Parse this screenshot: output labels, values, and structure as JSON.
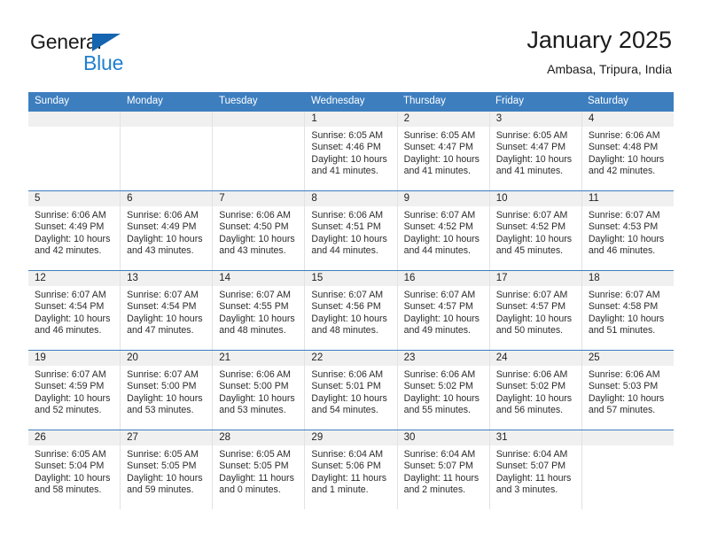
{
  "brand": {
    "word_one": "General",
    "word_two": "Blue",
    "accent_color": "#1f7fd0",
    "triangle_color": "#1565b0"
  },
  "header": {
    "title": "January 2025",
    "subtitle": "Ambasa, Tripura, India"
  },
  "calendar": {
    "header_bg": "#3d7ebf",
    "header_text_color": "#ffffff",
    "day_band_bg": "#f0f0f0",
    "weekdays": [
      "Sunday",
      "Monday",
      "Tuesday",
      "Wednesday",
      "Thursday",
      "Friday",
      "Saturday"
    ],
    "weeks": [
      [
        {
          "day": "",
          "sunrise": "",
          "sunset": "",
          "daylight_1": "",
          "daylight_2": ""
        },
        {
          "day": "",
          "sunrise": "",
          "sunset": "",
          "daylight_1": "",
          "daylight_2": ""
        },
        {
          "day": "",
          "sunrise": "",
          "sunset": "",
          "daylight_1": "",
          "daylight_2": ""
        },
        {
          "day": "1",
          "sunrise": "Sunrise: 6:05 AM",
          "sunset": "Sunset: 4:46 PM",
          "daylight_1": "Daylight: 10 hours",
          "daylight_2": "and 41 minutes."
        },
        {
          "day": "2",
          "sunrise": "Sunrise: 6:05 AM",
          "sunset": "Sunset: 4:47 PM",
          "daylight_1": "Daylight: 10 hours",
          "daylight_2": "and 41 minutes."
        },
        {
          "day": "3",
          "sunrise": "Sunrise: 6:05 AM",
          "sunset": "Sunset: 4:47 PM",
          "daylight_1": "Daylight: 10 hours",
          "daylight_2": "and 41 minutes."
        },
        {
          "day": "4",
          "sunrise": "Sunrise: 6:06 AM",
          "sunset": "Sunset: 4:48 PM",
          "daylight_1": "Daylight: 10 hours",
          "daylight_2": "and 42 minutes."
        }
      ],
      [
        {
          "day": "5",
          "sunrise": "Sunrise: 6:06 AM",
          "sunset": "Sunset: 4:49 PM",
          "daylight_1": "Daylight: 10 hours",
          "daylight_2": "and 42 minutes."
        },
        {
          "day": "6",
          "sunrise": "Sunrise: 6:06 AM",
          "sunset": "Sunset: 4:49 PM",
          "daylight_1": "Daylight: 10 hours",
          "daylight_2": "and 43 minutes."
        },
        {
          "day": "7",
          "sunrise": "Sunrise: 6:06 AM",
          "sunset": "Sunset: 4:50 PM",
          "daylight_1": "Daylight: 10 hours",
          "daylight_2": "and 43 minutes."
        },
        {
          "day": "8",
          "sunrise": "Sunrise: 6:06 AM",
          "sunset": "Sunset: 4:51 PM",
          "daylight_1": "Daylight: 10 hours",
          "daylight_2": "and 44 minutes."
        },
        {
          "day": "9",
          "sunrise": "Sunrise: 6:07 AM",
          "sunset": "Sunset: 4:52 PM",
          "daylight_1": "Daylight: 10 hours",
          "daylight_2": "and 44 minutes."
        },
        {
          "day": "10",
          "sunrise": "Sunrise: 6:07 AM",
          "sunset": "Sunset: 4:52 PM",
          "daylight_1": "Daylight: 10 hours",
          "daylight_2": "and 45 minutes."
        },
        {
          "day": "11",
          "sunrise": "Sunrise: 6:07 AM",
          "sunset": "Sunset: 4:53 PM",
          "daylight_1": "Daylight: 10 hours",
          "daylight_2": "and 46 minutes."
        }
      ],
      [
        {
          "day": "12",
          "sunrise": "Sunrise: 6:07 AM",
          "sunset": "Sunset: 4:54 PM",
          "daylight_1": "Daylight: 10 hours",
          "daylight_2": "and 46 minutes."
        },
        {
          "day": "13",
          "sunrise": "Sunrise: 6:07 AM",
          "sunset": "Sunset: 4:54 PM",
          "daylight_1": "Daylight: 10 hours",
          "daylight_2": "and 47 minutes."
        },
        {
          "day": "14",
          "sunrise": "Sunrise: 6:07 AM",
          "sunset": "Sunset: 4:55 PM",
          "daylight_1": "Daylight: 10 hours",
          "daylight_2": "and 48 minutes."
        },
        {
          "day": "15",
          "sunrise": "Sunrise: 6:07 AM",
          "sunset": "Sunset: 4:56 PM",
          "daylight_1": "Daylight: 10 hours",
          "daylight_2": "and 48 minutes."
        },
        {
          "day": "16",
          "sunrise": "Sunrise: 6:07 AM",
          "sunset": "Sunset: 4:57 PM",
          "daylight_1": "Daylight: 10 hours",
          "daylight_2": "and 49 minutes."
        },
        {
          "day": "17",
          "sunrise": "Sunrise: 6:07 AM",
          "sunset": "Sunset: 4:57 PM",
          "daylight_1": "Daylight: 10 hours",
          "daylight_2": "and 50 minutes."
        },
        {
          "day": "18",
          "sunrise": "Sunrise: 6:07 AM",
          "sunset": "Sunset: 4:58 PM",
          "daylight_1": "Daylight: 10 hours",
          "daylight_2": "and 51 minutes."
        }
      ],
      [
        {
          "day": "19",
          "sunrise": "Sunrise: 6:07 AM",
          "sunset": "Sunset: 4:59 PM",
          "daylight_1": "Daylight: 10 hours",
          "daylight_2": "and 52 minutes."
        },
        {
          "day": "20",
          "sunrise": "Sunrise: 6:07 AM",
          "sunset": "Sunset: 5:00 PM",
          "daylight_1": "Daylight: 10 hours",
          "daylight_2": "and 53 minutes."
        },
        {
          "day": "21",
          "sunrise": "Sunrise: 6:06 AM",
          "sunset": "Sunset: 5:00 PM",
          "daylight_1": "Daylight: 10 hours",
          "daylight_2": "and 53 minutes."
        },
        {
          "day": "22",
          "sunrise": "Sunrise: 6:06 AM",
          "sunset": "Sunset: 5:01 PM",
          "daylight_1": "Daylight: 10 hours",
          "daylight_2": "and 54 minutes."
        },
        {
          "day": "23",
          "sunrise": "Sunrise: 6:06 AM",
          "sunset": "Sunset: 5:02 PM",
          "daylight_1": "Daylight: 10 hours",
          "daylight_2": "and 55 minutes."
        },
        {
          "day": "24",
          "sunrise": "Sunrise: 6:06 AM",
          "sunset": "Sunset: 5:02 PM",
          "daylight_1": "Daylight: 10 hours",
          "daylight_2": "and 56 minutes."
        },
        {
          "day": "25",
          "sunrise": "Sunrise: 6:06 AM",
          "sunset": "Sunset: 5:03 PM",
          "daylight_1": "Daylight: 10 hours",
          "daylight_2": "and 57 minutes."
        }
      ],
      [
        {
          "day": "26",
          "sunrise": "Sunrise: 6:05 AM",
          "sunset": "Sunset: 5:04 PM",
          "daylight_1": "Daylight: 10 hours",
          "daylight_2": "and 58 minutes."
        },
        {
          "day": "27",
          "sunrise": "Sunrise: 6:05 AM",
          "sunset": "Sunset: 5:05 PM",
          "daylight_1": "Daylight: 10 hours",
          "daylight_2": "and 59 minutes."
        },
        {
          "day": "28",
          "sunrise": "Sunrise: 6:05 AM",
          "sunset": "Sunset: 5:05 PM",
          "daylight_1": "Daylight: 11 hours",
          "daylight_2": "and 0 minutes."
        },
        {
          "day": "29",
          "sunrise": "Sunrise: 6:04 AM",
          "sunset": "Sunset: 5:06 PM",
          "daylight_1": "Daylight: 11 hours",
          "daylight_2": "and 1 minute."
        },
        {
          "day": "30",
          "sunrise": "Sunrise: 6:04 AM",
          "sunset": "Sunset: 5:07 PM",
          "daylight_1": "Daylight: 11 hours",
          "daylight_2": "and 2 minutes."
        },
        {
          "day": "31",
          "sunrise": "Sunrise: 6:04 AM",
          "sunset": "Sunset: 5:07 PM",
          "daylight_1": "Daylight: 11 hours",
          "daylight_2": "and 3 minutes."
        },
        {
          "day": "",
          "sunrise": "",
          "sunset": "",
          "daylight_1": "",
          "daylight_2": ""
        }
      ]
    ]
  }
}
